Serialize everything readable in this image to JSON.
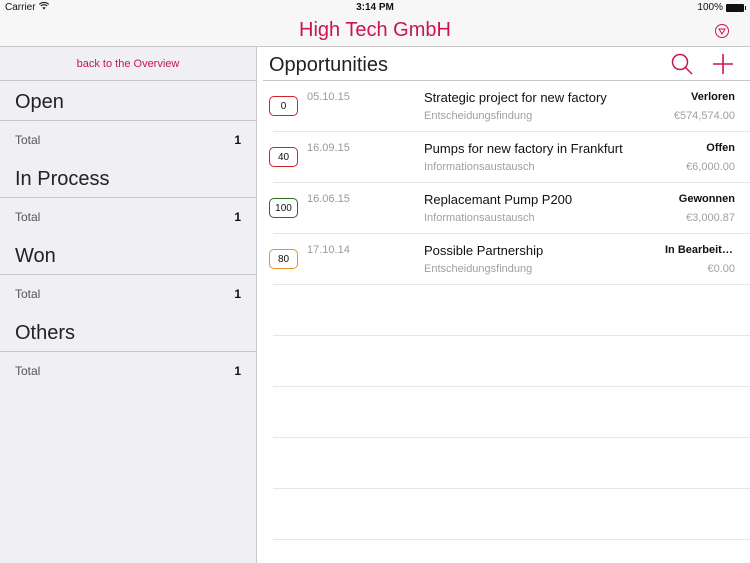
{
  "status_bar": {
    "carrier": "Carrier",
    "time": "3:14 PM",
    "battery": "100%"
  },
  "nav": {
    "title": "High Tech GmbH",
    "filter_icon": "filter-circle-icon"
  },
  "sidebar": {
    "back_label": "back to the Overview",
    "sections": [
      {
        "title": "Open",
        "row_label": "Total",
        "row_value": "1"
      },
      {
        "title": "In Process",
        "row_label": "Total",
        "row_value": "1"
      },
      {
        "title": "Won",
        "row_label": "Total",
        "row_value": "1"
      },
      {
        "title": "Others",
        "row_label": "Total",
        "row_value": "1"
      }
    ]
  },
  "main": {
    "heading": "Opportunities",
    "search_icon": "search-icon",
    "add_icon": "plus-icon",
    "colors": {
      "accent": "#c8174b",
      "badge_red": "#d0202a",
      "badge_green": "#2e6b1f",
      "badge_orange": "#e8902a"
    },
    "opportunities": [
      {
        "probability": "0",
        "badge_color": "#d0202a",
        "date": "05.10.15",
        "name": "Strategic project for new factory",
        "phase": "Entscheidungsfindung",
        "status": "Verloren",
        "amount": "€574,574.00"
      },
      {
        "probability": "40",
        "badge_color": "#d0202a",
        "date": "16.09.15",
        "name": "Pumps for new factory in Frankfurt",
        "phase": "Informationsaustausch",
        "status": "Offen",
        "amount": "€6,000.00"
      },
      {
        "probability": "100",
        "badge_color": "#2e6b1f",
        "date": "16.06.15",
        "name": "Replacemant Pump P200",
        "phase": "Informationsaustausch",
        "status": "Gewonnen",
        "amount": "€3,000.87"
      },
      {
        "probability": "80",
        "badge_color": "#e8902a",
        "date": "17.10.14",
        "name": "Possible Partnership",
        "phase": "Entscheidungsfindung",
        "status": "In Bearbeitung",
        "amount": "€0.00"
      }
    ]
  }
}
